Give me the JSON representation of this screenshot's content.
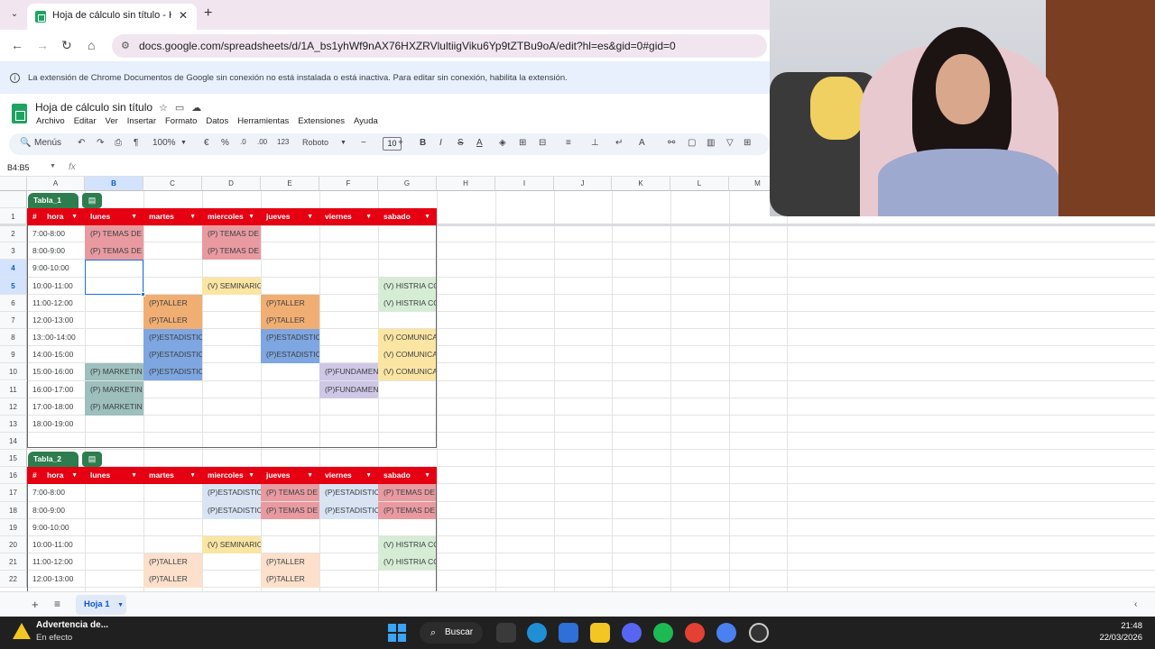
{
  "browser": {
    "tab_title": "Hoja de cálculo sin título - Hoja",
    "url": "docs.google.com/spreadsheets/d/1A_bs1yhWf9nAX76HXZRVlultiigViku6Yp9tZTBu9oA/edit?hl=es&gid=0#gid=0",
    "info_message": "La extensión de Chrome Documentos de Google sin conexión no está instalada o está inactiva. Para editar sin conexión, habilita la extensión."
  },
  "sheets": {
    "doc_title": "Hoja de cálculo sin título",
    "menu": [
      "Archivo",
      "Editar",
      "Ver",
      "Insertar",
      "Formato",
      "Datos",
      "Herramientas",
      "Extensiones",
      "Ayuda"
    ],
    "toolbar": {
      "menus_label": "Menús",
      "zoom": "100%",
      "currency": "€",
      "percent": "%",
      "num_format": "123",
      "font": "Roboto",
      "font_size": "10"
    },
    "name_box": "B4:B5",
    "columns": [
      "A",
      "B",
      "C",
      "D",
      "E",
      "F",
      "G",
      "H",
      "I",
      "J",
      "K",
      "L",
      "M"
    ],
    "rows": [
      "1",
      "2",
      "3",
      "4",
      "5",
      "6",
      "7",
      "8",
      "9",
      "10",
      "11",
      "12",
      "13",
      "14",
      "15",
      "16",
      "17",
      "18",
      "19",
      "20",
      "21",
      "22"
    ],
    "table1": {
      "name": "Tabla_1",
      "headers": [
        "hora",
        "lunes",
        "martes",
        "miercoles",
        "jueves",
        "viernes",
        "sabado"
      ],
      "hours": [
        "7:00-8:00",
        "8:00-9:00",
        "9:00-10:00",
        "10:00-11:00",
        "11:00-12:00",
        "12:00-13:00",
        "13::00-14:00",
        "14:00-15:00",
        "15:00-16:00",
        "16:00-17:00",
        "17:00-18:00",
        "18:00-19:00"
      ],
      "cells": {
        "b2": "(P) TEMAS DE H",
        "b3": "(P) TEMAS DE H",
        "d2": "(P) TEMAS DE H",
        "d3": "(P) TEMAS DE H",
        "d5": "(V) SEMINARIO",
        "g5": "(V) HISTRIA CO",
        "g6": "(V) HISTRIA CO",
        "c6": "(P)TALLER",
        "c7": "(P)TALLER",
        "e6": "(P)TALLER",
        "e7": "(P)TALLER",
        "c8": "(P)ESTADISTIC",
        "c9": "(P)ESTADISTIC",
        "c10": "(P)ESTADISTIC",
        "e8": "(P)ESTADISTIC",
        "e9": "(P)ESTADISTIC",
        "g8": "(V) COMUNICA",
        "g9": "(V) COMUNICA",
        "g10": "(V) COMUNICA",
        "b10": "(P) MARKETIN",
        "b11": "(P) MARKETIN",
        "b12": "(P) MARKETIN",
        "f10": "(P)FUNDAMENT",
        "f11": "(P)FUNDAMENT"
      }
    },
    "table2": {
      "name": "Tabla_2",
      "headers": [
        "hora",
        "lunes",
        "martes",
        "miercoles",
        "jueves",
        "viernes",
        "sabado"
      ],
      "hours": [
        "7:00-8:00",
        "8:00-9:00",
        "9:00-10:00",
        "10:00-11:00",
        "11:00-12:00",
        "12:00-13:00"
      ],
      "cells": {
        "d17": "(P)ESTADISTICA",
        "d18": "(P)ESTADISTICA",
        "e17": "(P) TEMAS DE H",
        "e18": "(P) TEMAS DE H",
        "f17": "(P)ESTADISTICA",
        "f18": "(P)ESTADISTICA",
        "g17": "(P) TEMAS DE H",
        "g18": "(P) TEMAS DE H",
        "d20": "(V) SEMINARIO",
        "g20": "(V) HISTRIA CO",
        "g21": "(V) HISTRIA CO",
        "c21": "(P)TALLER",
        "c22": "(P)TALLER",
        "e21": "(P)TALLER",
        "e22": "(P)TALLER"
      }
    },
    "sheet_tab": "Hoja 1"
  },
  "taskbar": {
    "warning_title": "Advertencia de...",
    "warning_sub": "En efecto",
    "search_label": "Buscar",
    "time": "21:48",
    "date": "22/03/2026"
  }
}
